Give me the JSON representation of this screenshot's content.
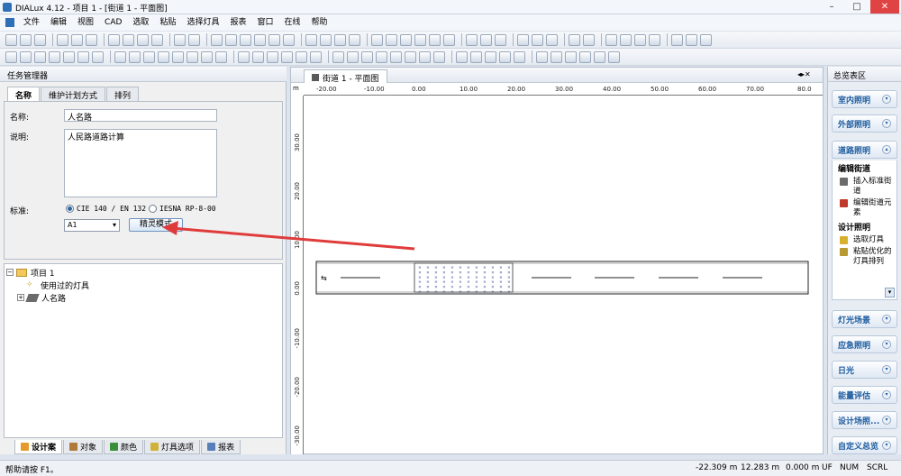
{
  "window": {
    "title": "DIALux 4.12 - 项目 1 - [街道 1 - 平面图]",
    "min": "–",
    "max": "□",
    "close": "✕"
  },
  "menu": [
    "文件",
    "编辑",
    "视图",
    "CAD",
    "选取",
    "粘贴",
    "选择灯具",
    "报表",
    "窗口",
    "在线",
    "帮助"
  ],
  "task_manager": {
    "title": "任务管理器",
    "tabs": [
      "名称",
      "维护计划方式",
      "排列"
    ],
    "name_label": "名称:",
    "name_value": "人名路",
    "desc_label": "说明:",
    "desc_value": "人民路道路计算",
    "standard_label": "标准:",
    "radio1": "CIE 140 / EN 132",
    "radio2": "IESNA RP-8-00",
    "select_value": "A1",
    "wizard_button": "精灵模式"
  },
  "tree": {
    "root": "项目 1",
    "child1": "使用过的灯具",
    "child2": "人名路"
  },
  "bottom_tabs": [
    "设计案",
    "对象",
    "颜色",
    "灯具选项",
    "报表"
  ],
  "document": {
    "tab": "街道 1 - 平面图",
    "ruler_unit": "m",
    "x_ticks": [
      "-20.00",
      "-10.00",
      "0.00",
      "10.00",
      "20.00",
      "30.00",
      "40.00",
      "50.00",
      "60.00",
      "70.00",
      "80.0"
    ],
    "y_ticks": [
      "30.00",
      "20.00",
      "10.00",
      "0.00",
      "-10.00",
      "-20.00",
      "-30.00"
    ]
  },
  "right_panel": {
    "title": "总览表区",
    "sections": [
      "室内照明",
      "外部照明",
      "道路照明",
      "灯光场景",
      "应急照明",
      "日光",
      "能量评估",
      "设计场照...",
      "自定义总览"
    ],
    "edit_street": "编辑街道",
    "items": [
      "插入标准街道",
      "编辑街道元素"
    ],
    "design_lighting": "设计照明",
    "items2": [
      "选取灯具",
      "粘贴优化的灯具排列"
    ]
  },
  "status": {
    "help": "帮助请按 F1。",
    "x": "-22.309 m",
    "y": "12.283 m",
    "z": "0.000 m",
    "uf": "UF",
    "num": "NUM",
    "scrl": "SCRL"
  },
  "colors": {
    "accent": "#1c5b9e",
    "arrow": "#e03b3b"
  }
}
